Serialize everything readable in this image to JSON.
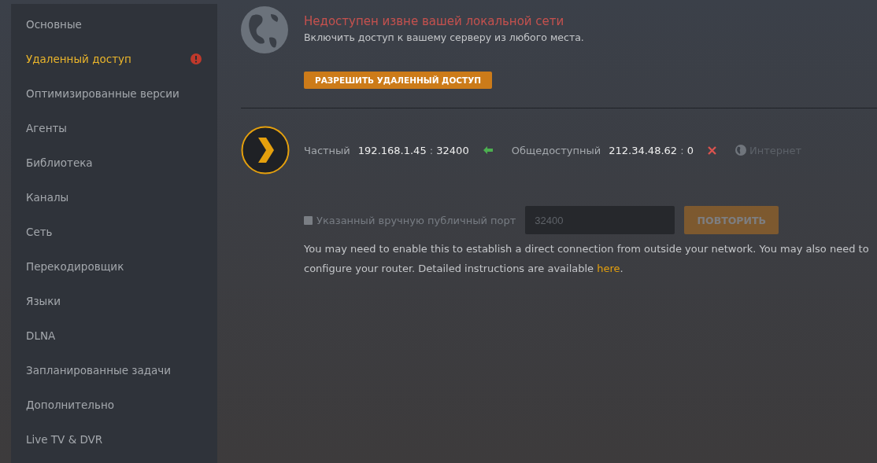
{
  "sidebar": {
    "items": [
      {
        "label": "Основные",
        "selected": false,
        "alert": false
      },
      {
        "label": "Удаленный доступ",
        "selected": true,
        "alert": true
      },
      {
        "label": "Оптимизированные версии",
        "selected": false,
        "alert": false
      },
      {
        "label": "Агенты",
        "selected": false,
        "alert": false
      },
      {
        "label": "Библиотека",
        "selected": false,
        "alert": false
      },
      {
        "label": "Каналы",
        "selected": false,
        "alert": false
      },
      {
        "label": "Сеть",
        "selected": false,
        "alert": false
      },
      {
        "label": "Перекодировщик",
        "selected": false,
        "alert": false
      },
      {
        "label": "Языки",
        "selected": false,
        "alert": false
      },
      {
        "label": "DLNA",
        "selected": false,
        "alert": false
      },
      {
        "label": "Запланированные задачи",
        "selected": false,
        "alert": false
      },
      {
        "label": "Дополнительно",
        "selected": false,
        "alert": false
      },
      {
        "label": "Live TV & DVR",
        "selected": false,
        "alert": false
      }
    ]
  },
  "status": {
    "title": "Недоступен извне вашей локальной сети",
    "subtitle": "Включить доступ к вашему серверу из любого места.",
    "button": "РАЗРЕШИТЬ УДАЛЕННЫЙ ДОСТУП"
  },
  "connection": {
    "private": {
      "label": "Частный",
      "address": "192.168.1.45",
      "separator": ":",
      "port": "32400",
      "reachable": true
    },
    "public": {
      "label": "Общедоступный",
      "address": "212.34.48.62",
      "separator": ":",
      "port": "0",
      "reachable": false
    },
    "internet": {
      "label": "Интернет",
      "reachable": false
    }
  },
  "manual_port": {
    "checked": false,
    "disabled": true,
    "label": "Указанный вручную публичный порт",
    "placeholder": "32400",
    "button": "ПОВТОРИТЬ"
  },
  "note": {
    "text": "You may need to enable this to establish a direct connection from outside your network. You may also need to configure your router. Detailed instructions are available ",
    "link": "here",
    "after": "."
  }
}
